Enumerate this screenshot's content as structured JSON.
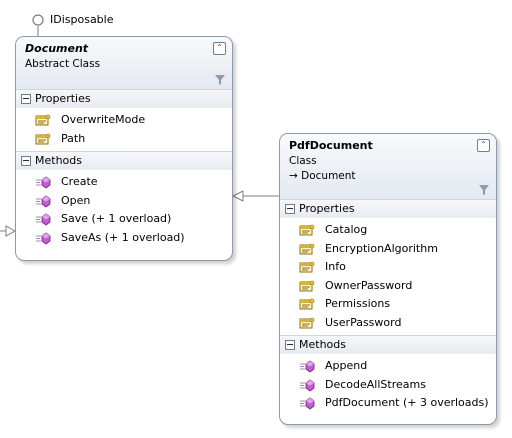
{
  "interface_label": "IDisposable",
  "classes": [
    {
      "name": "Document",
      "stereotype": "Abstract Class",
      "base": "",
      "collapse_glyph": "⌃",
      "compartments": [
        {
          "label": "Properties",
          "kind": "property",
          "members": [
            "OverwriteMode",
            "Path"
          ]
        },
        {
          "label": "Methods",
          "kind": "method",
          "members": [
            "Create",
            "Open",
            "Save (+ 1 overload)",
            "SaveAs (+ 1 overload)"
          ]
        }
      ]
    },
    {
      "name": "PdfDocument",
      "stereotype": "Class",
      "base": "→ Document",
      "collapse_glyph": "⌃",
      "compartments": [
        {
          "label": "Properties",
          "kind": "property",
          "members": [
            "Catalog",
            "EncryptionAlgorithm",
            "Info",
            "OwnerPassword",
            "Permissions",
            "UserPassword"
          ]
        },
        {
          "label": "Methods",
          "kind": "method",
          "members": [
            "Append",
            "DecodeAllStreams",
            "PdfDocument (+ 3 overloads)"
          ]
        }
      ]
    }
  ],
  "colors": {
    "border": "#8c99a8",
    "property_icon": "#c9a227",
    "method_icon": "#a43bb0",
    "connector": "#7d7d7d"
  },
  "icons": {
    "interface": "lollipop-icon",
    "property": "property-icon",
    "method": "method-icon",
    "filter": "filter-icon",
    "collapse": "collapse-icon"
  }
}
